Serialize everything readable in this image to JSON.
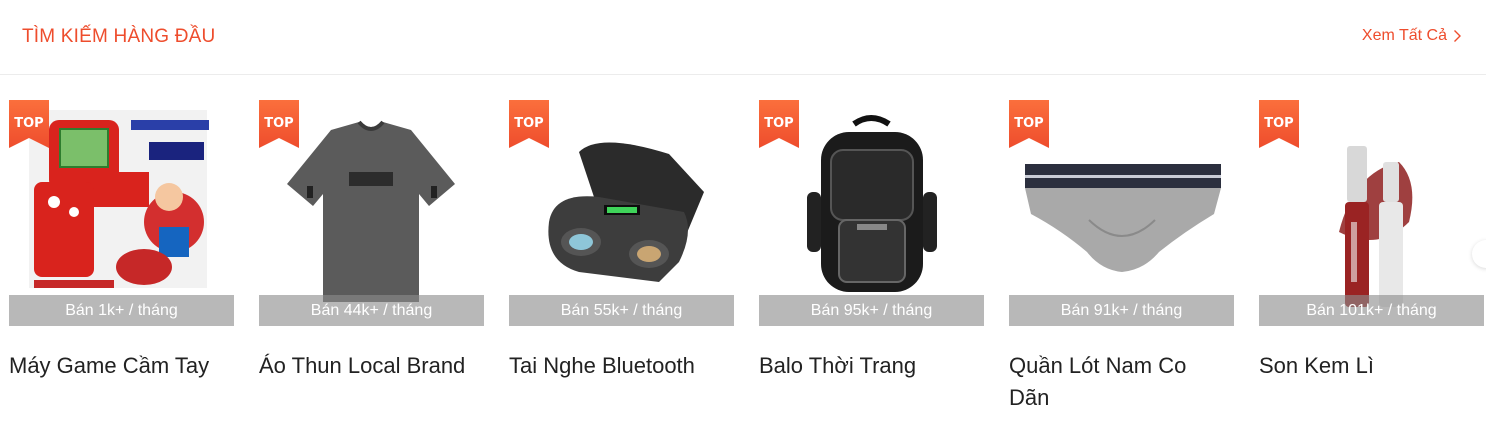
{
  "header": {
    "title": "TÌM KIẾM HÀNG ĐẦU",
    "see_all": "Xem Tất Cả"
  },
  "badge_label": "TOP",
  "colors": {
    "accent": "#ee4d2d",
    "badge_top": "#fb6f3c",
    "badge_bottom": "#ee4d2d"
  },
  "products": [
    {
      "name": "Máy Game Cầm Tay",
      "sold": "Bán 1k+ / tháng"
    },
    {
      "name": "Áo Thun Local Brand",
      "sold": "Bán 44k+ / tháng"
    },
    {
      "name": "Tai Nghe Bluetooth",
      "sold": "Bán 55k+ / tháng"
    },
    {
      "name": "Balo Thời Trang",
      "sold": "Bán 95k+ / tháng"
    },
    {
      "name": "Quần Lót Nam Co Dãn",
      "sold": "Bán 91k+ / tháng"
    },
    {
      "name": "Son Kem Lì",
      "sold": "Bán 101k+ / tháng"
    }
  ],
  "icons": {
    "see_all": "chevron-right-icon",
    "next": "carousel-next-icon"
  }
}
